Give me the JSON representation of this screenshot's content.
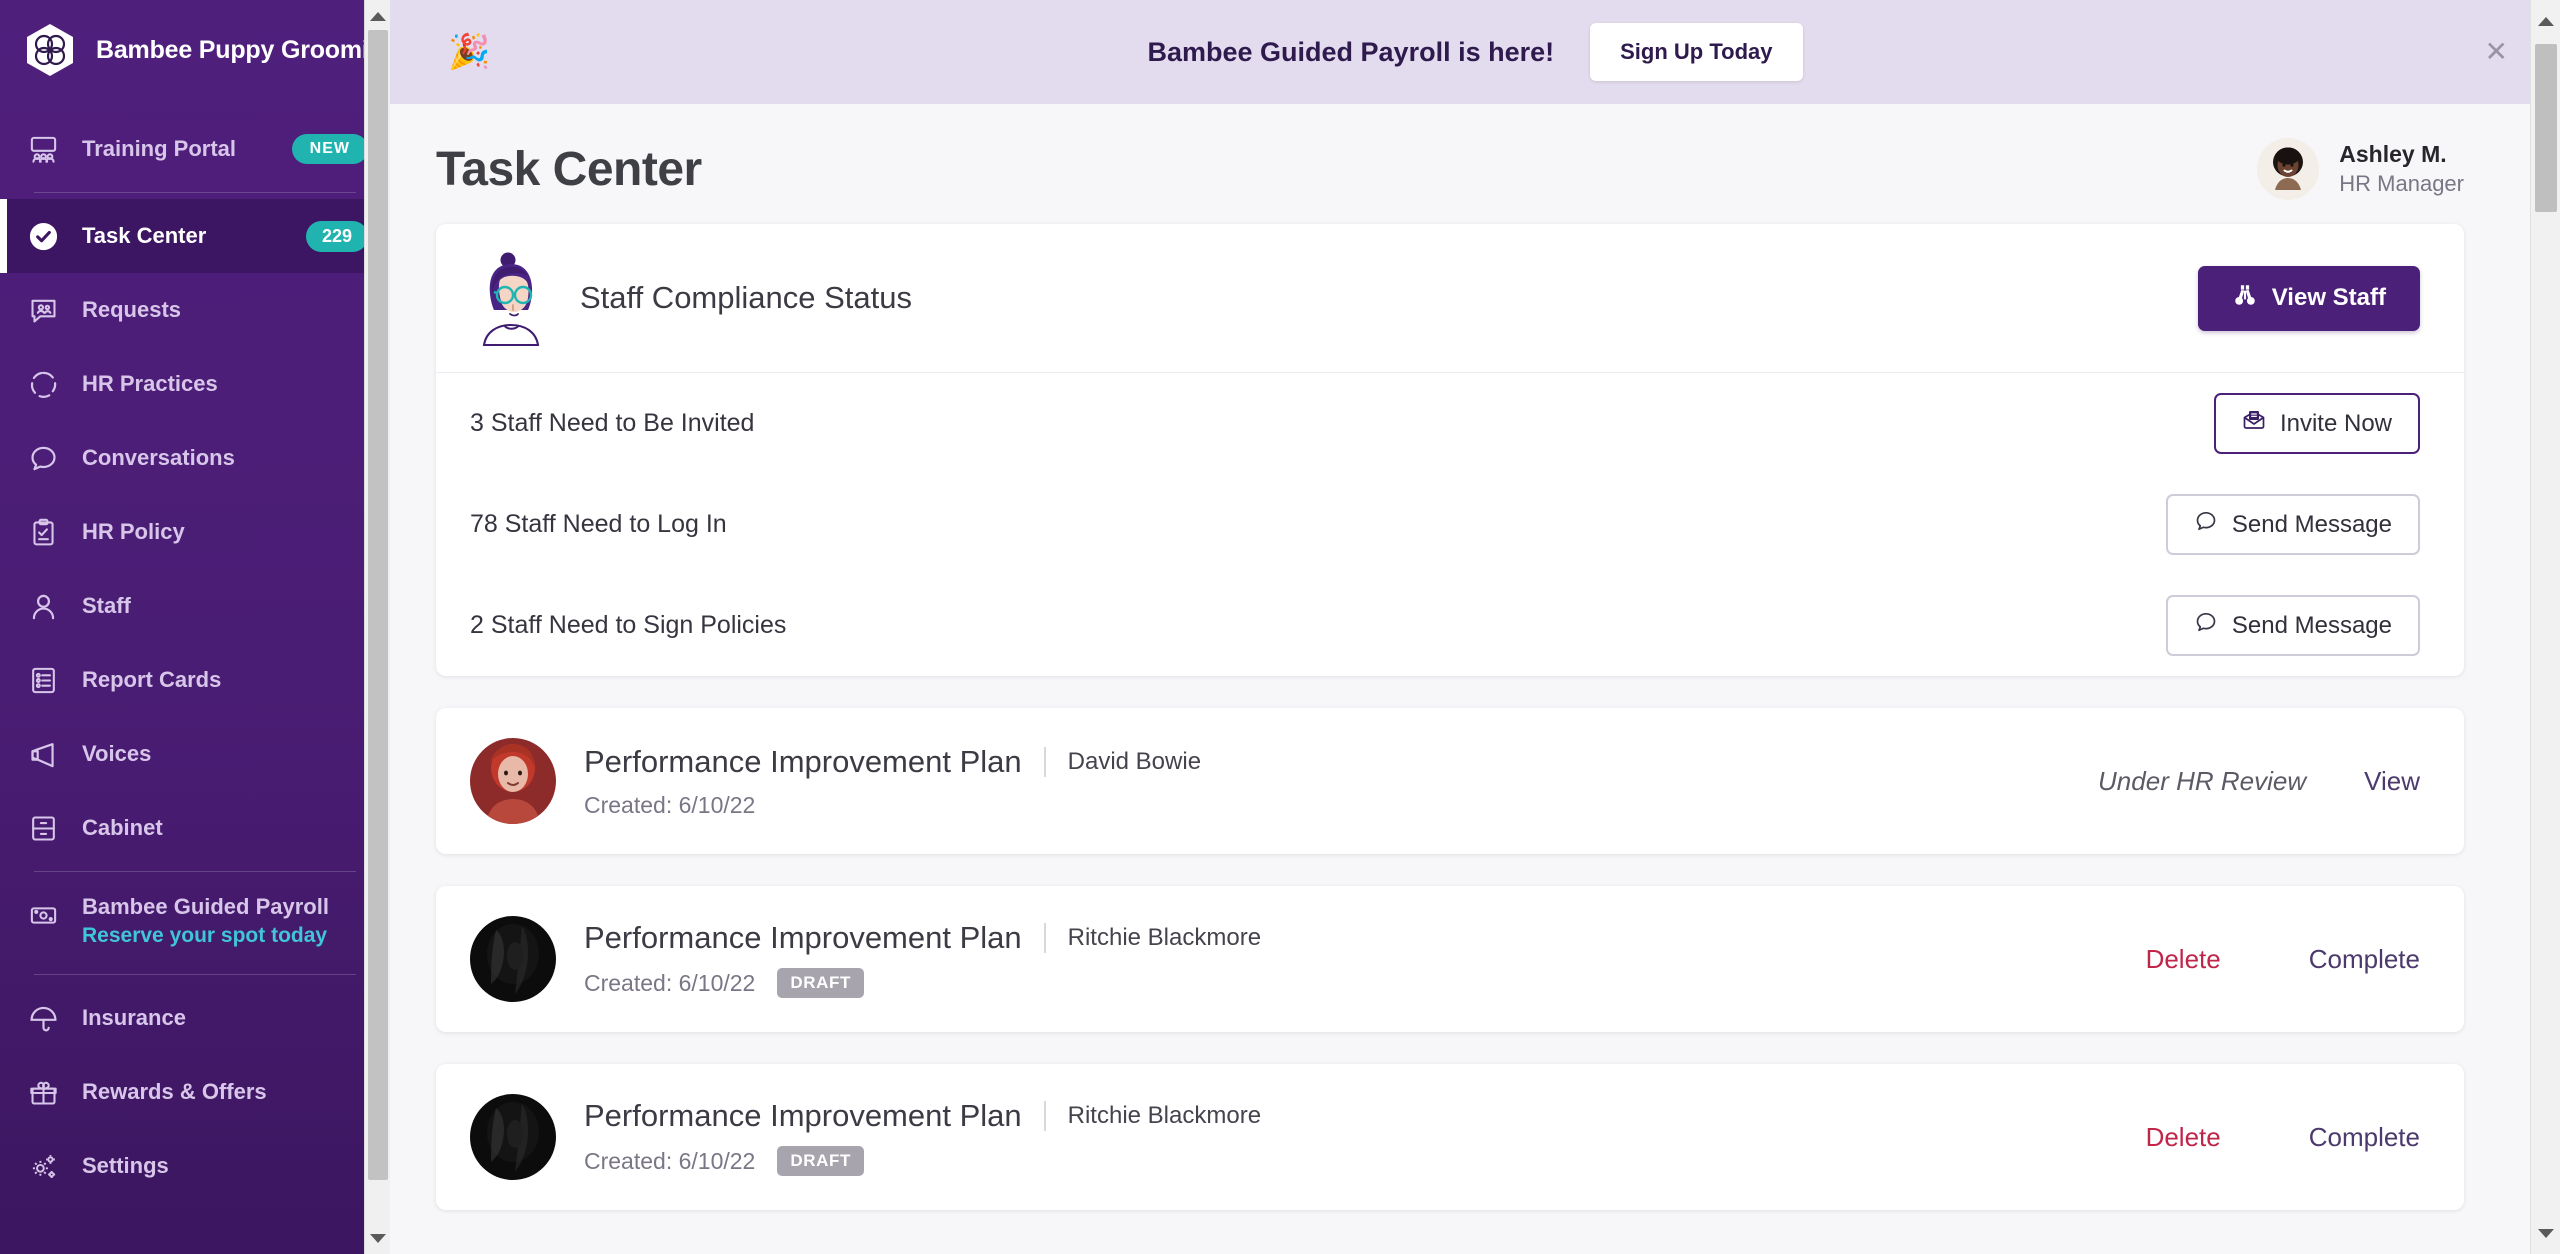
{
  "sidebar": {
    "brand": {
      "name": "Bambee Puppy Grooming",
      "logo_icon": "bambee-clover-logo"
    },
    "items": [
      {
        "label": "Training Portal",
        "icon": "people-board-icon",
        "badge": "NEW",
        "badge_type": "new",
        "active": false
      },
      {
        "label": "Task Center",
        "icon": "check-circle-icon",
        "badge": "229",
        "badge_type": "count",
        "active": true
      },
      {
        "label": "Requests",
        "icon": "requests-bubble-icon",
        "badge": "",
        "badge_type": "",
        "active": false
      },
      {
        "label": "HR Practices",
        "icon": "circle-dashes-icon",
        "badge": "",
        "badge_type": "",
        "active": false
      },
      {
        "label": "Conversations",
        "icon": "chat-bubble-icon",
        "badge": "",
        "badge_type": "",
        "active": false
      },
      {
        "label": "HR Policy",
        "icon": "clipboard-check-icon",
        "badge": "",
        "badge_type": "",
        "active": false
      },
      {
        "label": "Staff",
        "icon": "user-icon",
        "badge": "",
        "badge_type": "",
        "active": false
      },
      {
        "label": "Report Cards",
        "icon": "report-list-icon",
        "badge": "",
        "badge_type": "",
        "active": false
      },
      {
        "label": "Voices",
        "icon": "megaphone-icon",
        "badge": "",
        "badge_type": "",
        "active": false
      },
      {
        "label": "Cabinet",
        "icon": "file-cabinet-icon",
        "badge": "",
        "badge_type": "",
        "active": false
      }
    ],
    "payroll_promo": {
      "label": "Bambee Guided Payroll",
      "sublabel": "Reserve your spot today",
      "icon": "money-bill-icon"
    },
    "items_bottom": [
      {
        "label": "Insurance",
        "icon": "umbrella-icon"
      },
      {
        "label": "Rewards & Offers",
        "icon": "gift-icon"
      },
      {
        "label": "Settings",
        "icon": "gears-icon"
      }
    ],
    "colors": {
      "background": "#4a1d74",
      "active": "#3d1663",
      "accent_teal": "#21b3b0",
      "link_teal": "#3fc6d8"
    }
  },
  "banner": {
    "emoji_icon": "party-popper-icon",
    "text": "Bambee Guided Payroll is here!",
    "cta_label": "Sign Up Today",
    "close_icon": "close-icon",
    "background": "#e3dcee"
  },
  "header": {
    "title": "Task Center",
    "user": {
      "name": "Ashley M.",
      "role": "HR Manager",
      "avatar_icon": "user-avatar"
    }
  },
  "compliance_card": {
    "illustration_icon": "person-glasses-illustration",
    "title": "Staff Compliance Status",
    "action": {
      "label": "View Staff",
      "icon": "binoculars-icon",
      "color": "#4b2079"
    },
    "rows": [
      {
        "label": "3 Staff Need to Be Invited",
        "action_label": "Invite Now",
        "action_icon": "envelope-invite-icon",
        "style": "dark"
      },
      {
        "label": "78 Staff Need to Log In",
        "action_label": "Send Message",
        "action_icon": "message-bubble-icon",
        "style": "light"
      },
      {
        "label": "2 Staff Need to Sign Policies",
        "action_label": "Send Message",
        "action_icon": "message-bubble-icon",
        "style": "light"
      }
    ]
  },
  "tasks": [
    {
      "title": "Performance Improvement Plan",
      "person": "David Bowie",
      "created_label": "Created: 6/10/22",
      "draft_badge": "",
      "avatar_icon": "avatar-david-bowie",
      "status": "Under HR Review",
      "actions": [
        {
          "label": "View",
          "kind": "view"
        }
      ]
    },
    {
      "title": "Performance Improvement Plan",
      "person": "Ritchie Blackmore",
      "created_label": "Created: 6/10/22",
      "draft_badge": "DRAFT",
      "avatar_icon": "avatar-ritchie-blackmore",
      "status": "",
      "actions": [
        {
          "label": "Delete",
          "kind": "delete"
        },
        {
          "label": "Complete",
          "kind": "complete"
        }
      ]
    },
    {
      "title": "Performance Improvement Plan",
      "person": "Ritchie Blackmore",
      "created_label": "Created: 6/10/22",
      "draft_badge": "DRAFT",
      "avatar_icon": "avatar-ritchie-blackmore",
      "status": "",
      "actions": [
        {
          "label": "Delete",
          "kind": "delete"
        },
        {
          "label": "Complete",
          "kind": "complete"
        }
      ]
    }
  ]
}
